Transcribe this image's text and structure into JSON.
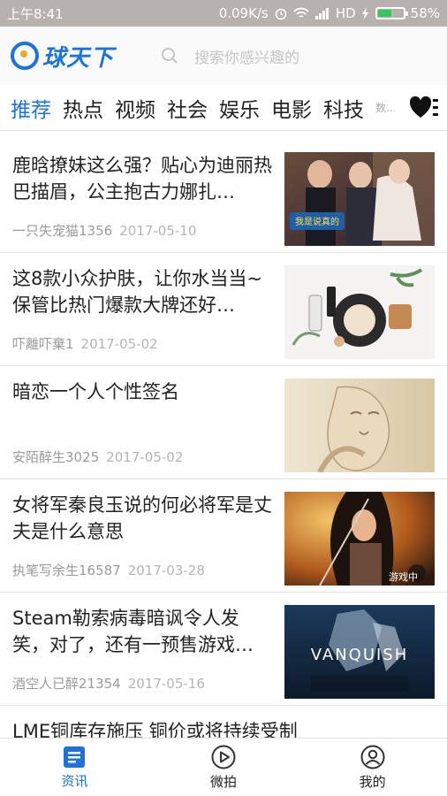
{
  "status_bar": {
    "time": "上午8:41",
    "speed": "0.09K/s",
    "network": "HD",
    "battery": "58%",
    "battery_level": 0.58
  },
  "header": {
    "logo_text": "球天下",
    "search_placeholder": "搜索你感兴趣的"
  },
  "tabs": [
    {
      "label": "推荐",
      "active": true
    },
    {
      "label": "热点",
      "active": false
    },
    {
      "label": "视频",
      "active": false
    },
    {
      "label": "社会",
      "active": false
    },
    {
      "label": "娱乐",
      "active": false
    },
    {
      "label": "电影",
      "active": false
    },
    {
      "label": "科技",
      "active": false
    },
    {
      "label": "数…",
      "active": false
    }
  ],
  "feed": [
    {
      "title": "鹿晗撩妹这么强？贴心为迪丽热巴描眉，公主抱古力娜扎…",
      "author": "一只失宠猫1356",
      "date": "2017-05-10",
      "thumb_text": "我是说真的"
    },
    {
      "title": "这8款小众护肤，让你水当当~保管比热门爆款大牌还好…",
      "author": "吓離吓棄1",
      "date": "2017-05-02"
    },
    {
      "title": "暗恋一个人个性签名",
      "author": "安陌醉生3025",
      "date": "2017-05-02"
    },
    {
      "title": "女将军秦良玉说的何必将军是丈夫是什么意思",
      "author": "执笔写余生16587",
      "date": "2017-03-28",
      "thumb_text": "游戏中"
    },
    {
      "title": "Steam勒索病毒暗讽令人发笑，对了，还有一预售游戏…",
      "author": "酒空人已醉21354",
      "date": "2017-05-16",
      "thumb_text": "VANQUISH"
    },
    {
      "title": "LME铜库存施压 铜价或将持续受制",
      "author": "",
      "date": ""
    }
  ],
  "bottom_nav": [
    {
      "label": "资讯",
      "icon": "news-icon",
      "active": true
    },
    {
      "label": "微拍",
      "icon": "play-icon",
      "active": false
    },
    {
      "label": "我的",
      "icon": "profile-icon",
      "active": false
    }
  ],
  "colors": {
    "accent": "#1e73d9",
    "status_bar": "#b7b2ad"
  }
}
